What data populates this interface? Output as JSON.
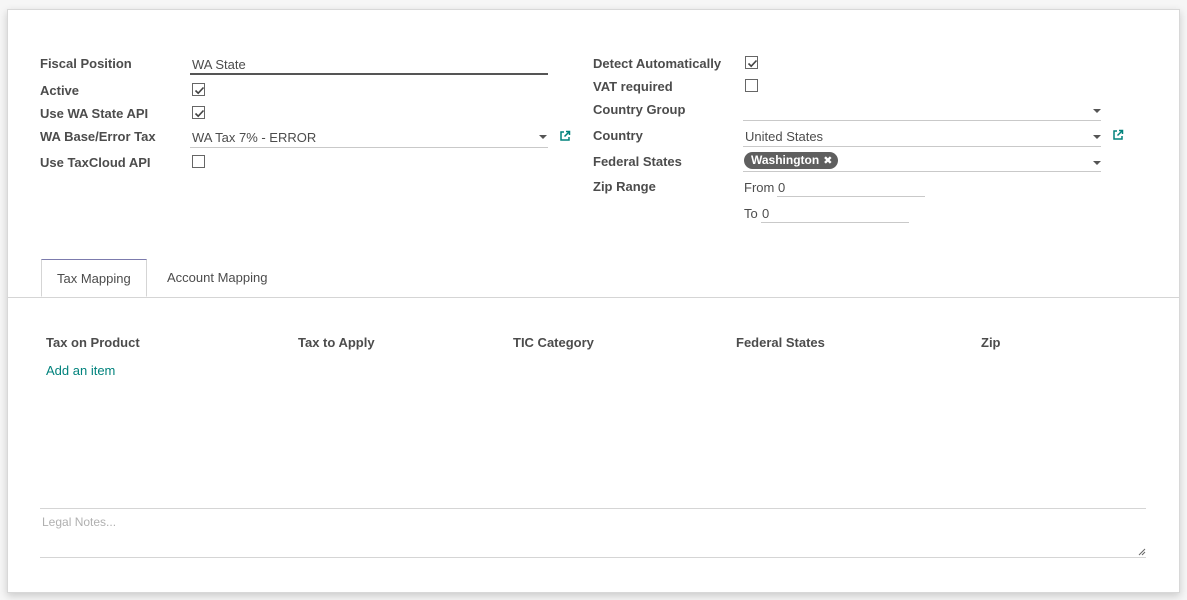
{
  "form": {
    "left": {
      "fiscal_position_label": "Fiscal Position",
      "fiscal_position_value": "WA State",
      "active_label": "Active",
      "active_checked": true,
      "use_wa_api_label": "Use WA State API",
      "use_wa_api_checked": true,
      "wa_base_label": "WA Base/Error Tax",
      "wa_base_value": "WA Tax 7% - ERROR",
      "taxcloud_label": "Use TaxCloud API",
      "taxcloud_checked": false
    },
    "right": {
      "detect_label": "Detect Automatically",
      "detect_checked": true,
      "vat_label": "VAT required",
      "vat_checked": false,
      "country_group_label": "Country Group",
      "country_group_value": "",
      "country_label": "Country",
      "country_value": "United States",
      "federal_states_label": "Federal States",
      "federal_states_tags": [
        "Washington"
      ],
      "zip_range_label": "Zip Range",
      "zip_from_label": "From",
      "zip_from_value": "0",
      "zip_to_label": "To",
      "zip_to_value": "0"
    }
  },
  "tabs": [
    {
      "label": "Tax Mapping",
      "active": true
    },
    {
      "label": "Account Mapping",
      "active": false
    }
  ],
  "tax_table": {
    "columns": [
      "Tax on Product",
      "Tax to Apply",
      "TIC Category",
      "Federal States",
      "Zip"
    ],
    "add_item_label": "Add an item"
  },
  "notes": {
    "placeholder": "Legal Notes..."
  },
  "colors": {
    "link": "#00827c",
    "tag_bg": "#5f5f5f",
    "tab_accent": "#7c7bad"
  },
  "icons": {
    "checkbox_check": "check-icon",
    "dropdown": "caret-down-icon",
    "external": "external-link-icon",
    "tag_remove": "close-icon"
  }
}
